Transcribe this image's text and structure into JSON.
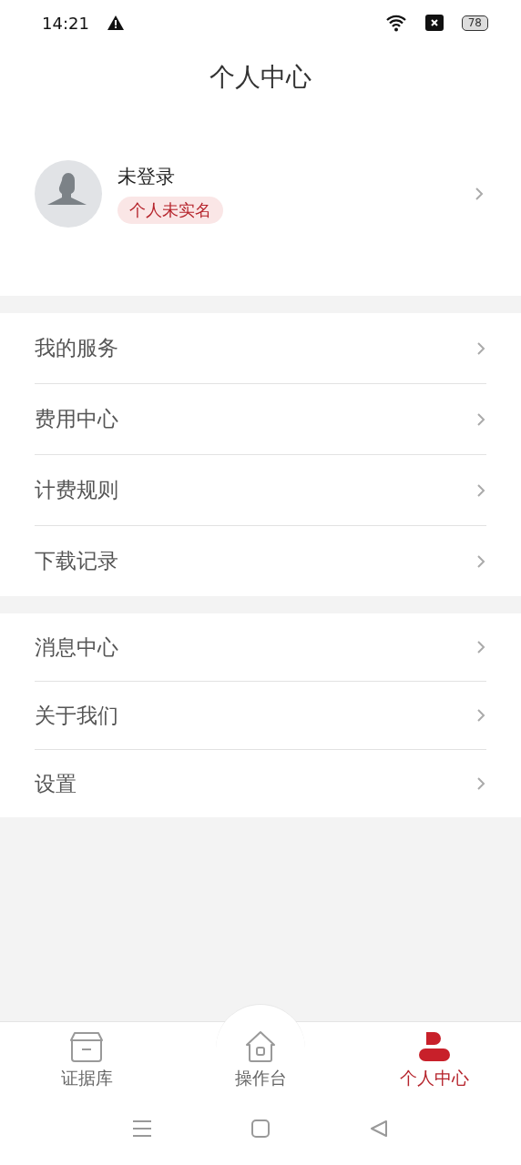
{
  "status_bar": {
    "time": "14:21",
    "battery": "78"
  },
  "header": {
    "title": "个人中心"
  },
  "profile": {
    "name": "未登录",
    "badge": "个人未实名"
  },
  "menu_groups": [
    {
      "items": [
        "我的服务",
        "费用中心",
        "计费规则",
        "下载记录"
      ]
    },
    {
      "items": [
        "消息中心",
        "关于我们",
        "设置"
      ]
    }
  ],
  "tabs": [
    {
      "label": "证据库",
      "selected": false
    },
    {
      "label": "操作台",
      "selected": false
    },
    {
      "label": "个人中心",
      "selected": true
    }
  ]
}
